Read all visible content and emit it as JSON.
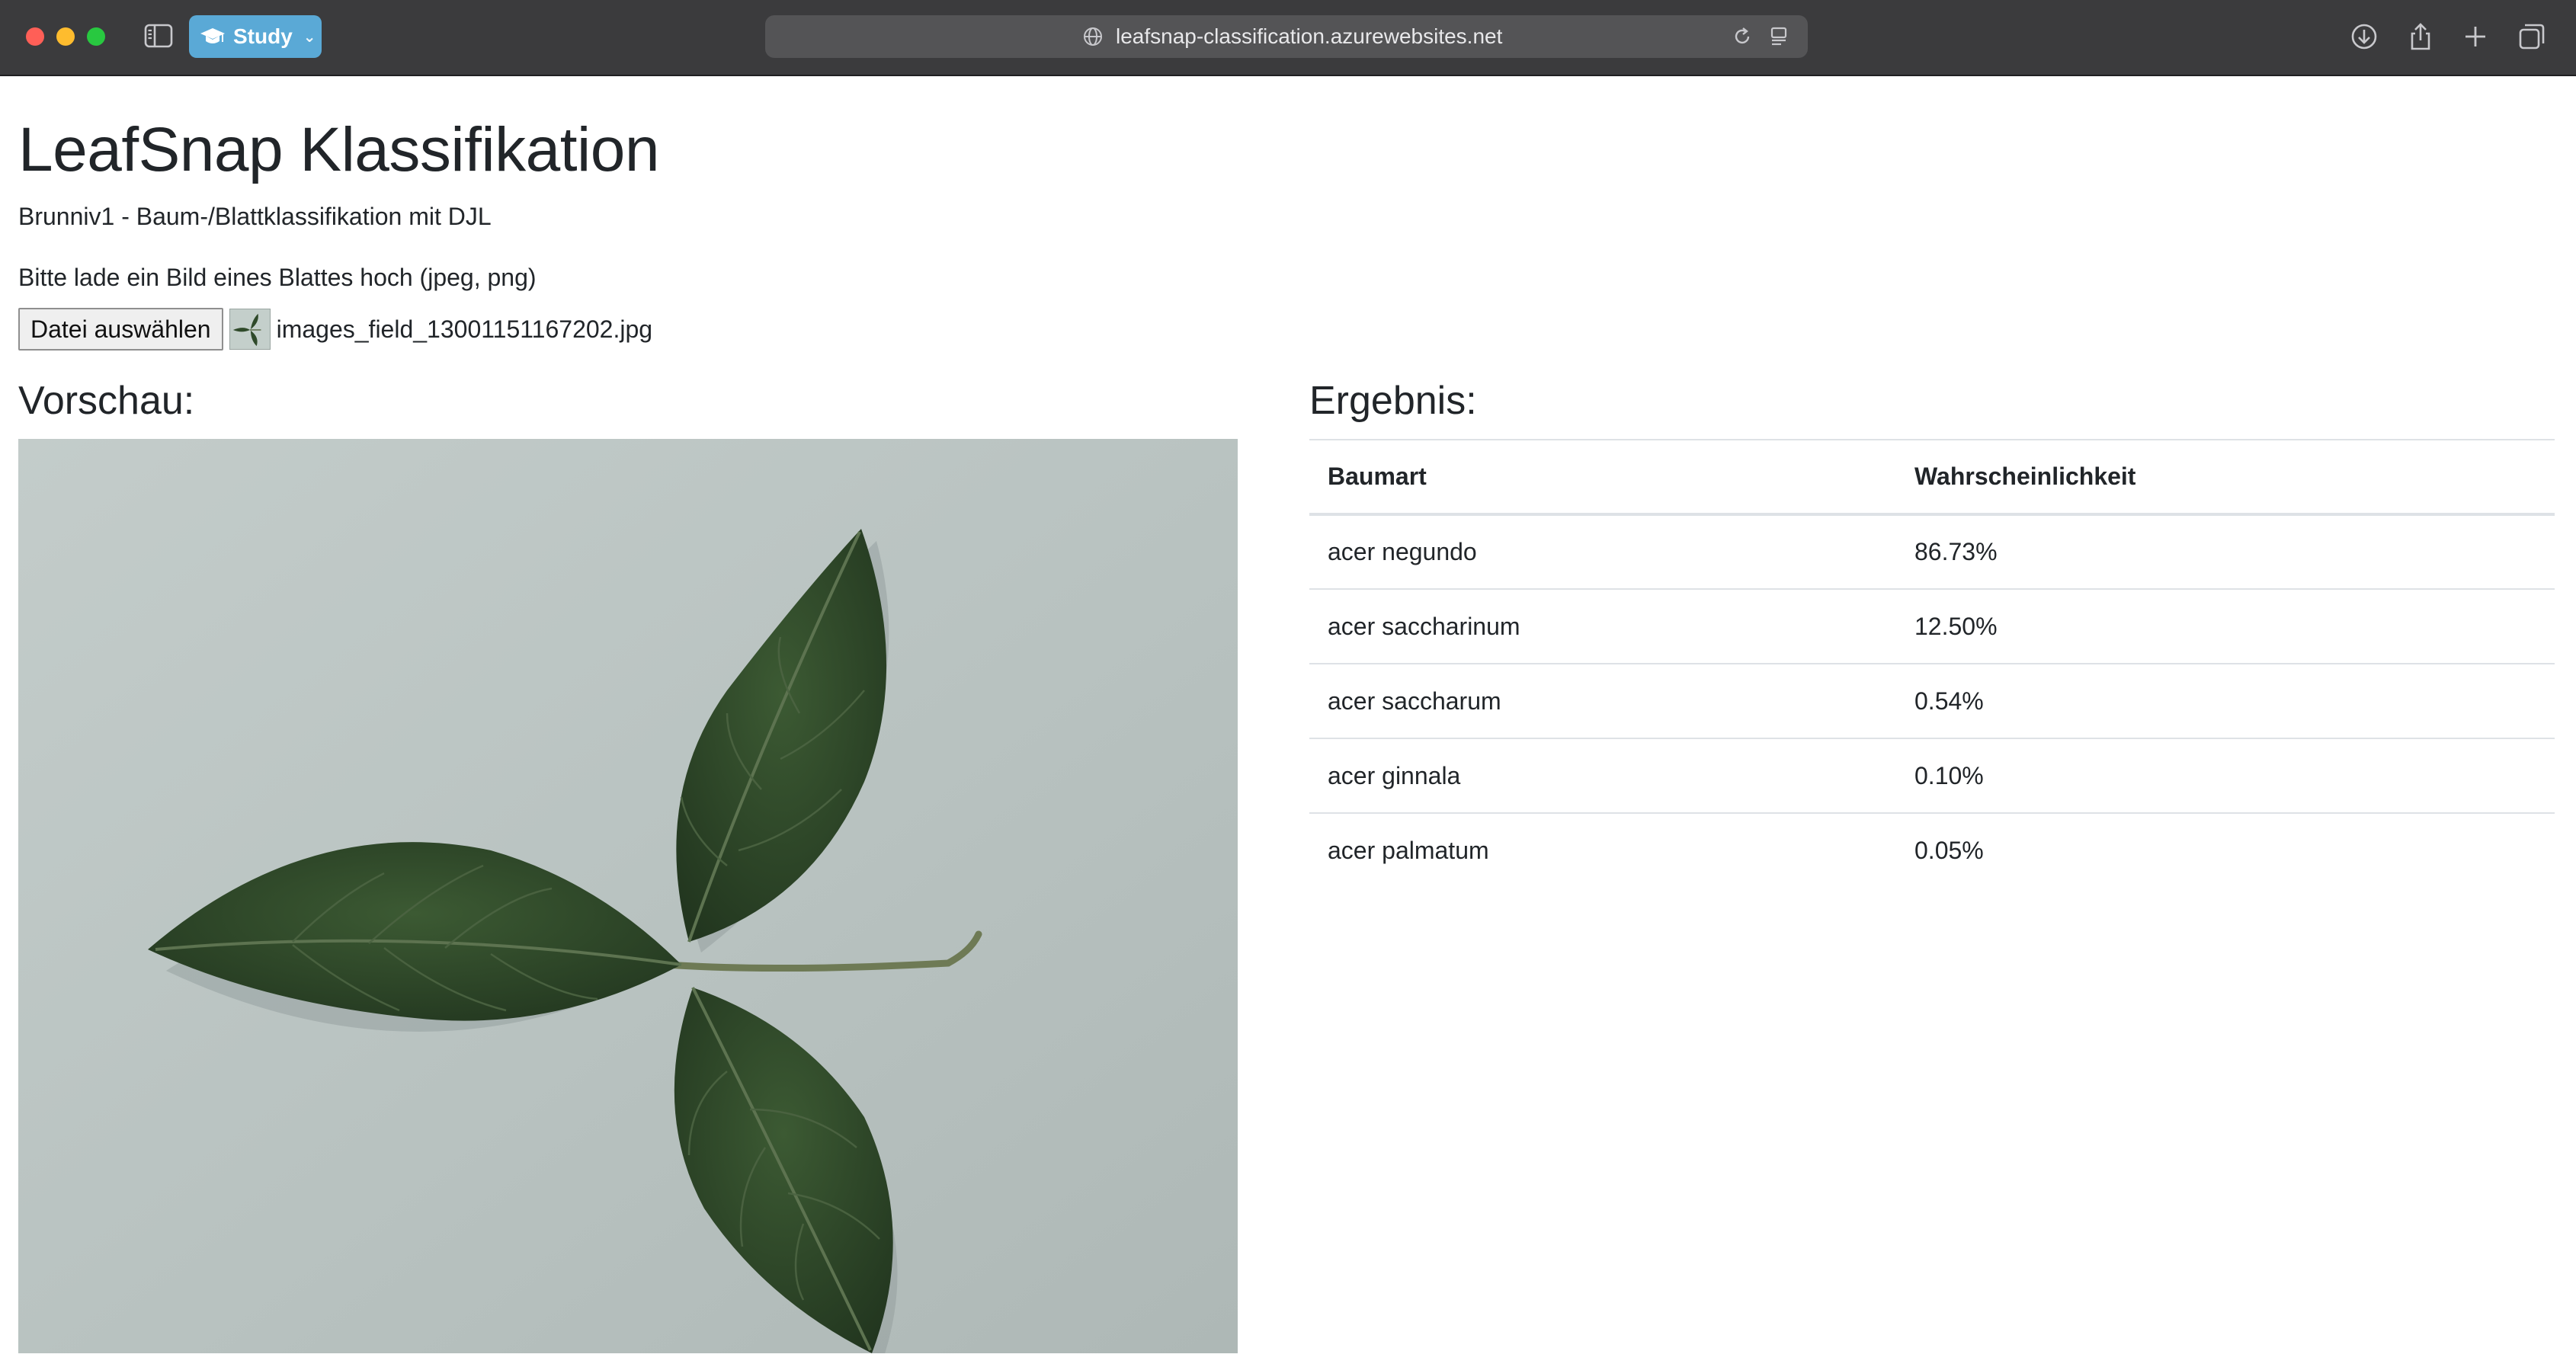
{
  "browser": {
    "profile_label": "Study",
    "url": "leafsnap-classification.azurewebsites.net",
    "icons": [
      "sidebar-icon",
      "graduation-cap-icon",
      "globe-icon",
      "reload-icon",
      "reader-icon",
      "download-icon",
      "share-icon",
      "new-tab-icon",
      "tab-overview-icon"
    ],
    "colors": {
      "toolbar": "#3b3b3d",
      "profile_pill": "#5aa9d6",
      "address_bar": "#545456"
    }
  },
  "page": {
    "title": "LeafSnap Klassifikation",
    "subtitle": "Brunniv1 - Baum-/Blattklassifikation mit DJL",
    "instruction": "Bitte lade ein Bild eines Blattes hoch (jpeg, png)",
    "file_button_label": "Datei auswählen",
    "file_name": "images_field_13001151167202.jpg",
    "preview_heading": "Vorschau:",
    "result_heading": "Ergebnis:"
  },
  "results": {
    "columns": [
      "Baumart",
      "Wahrscheinlichkeit"
    ],
    "rows": [
      {
        "species": "acer negundo",
        "probability": "86.73%"
      },
      {
        "species": "acer saccharinum",
        "probability": "12.50%"
      },
      {
        "species": "acer saccharum",
        "probability": "0.54%"
      },
      {
        "species": "acer ginnala",
        "probability": "0.10%"
      },
      {
        "species": "acer palmatum",
        "probability": "0.05%"
      }
    ]
  }
}
